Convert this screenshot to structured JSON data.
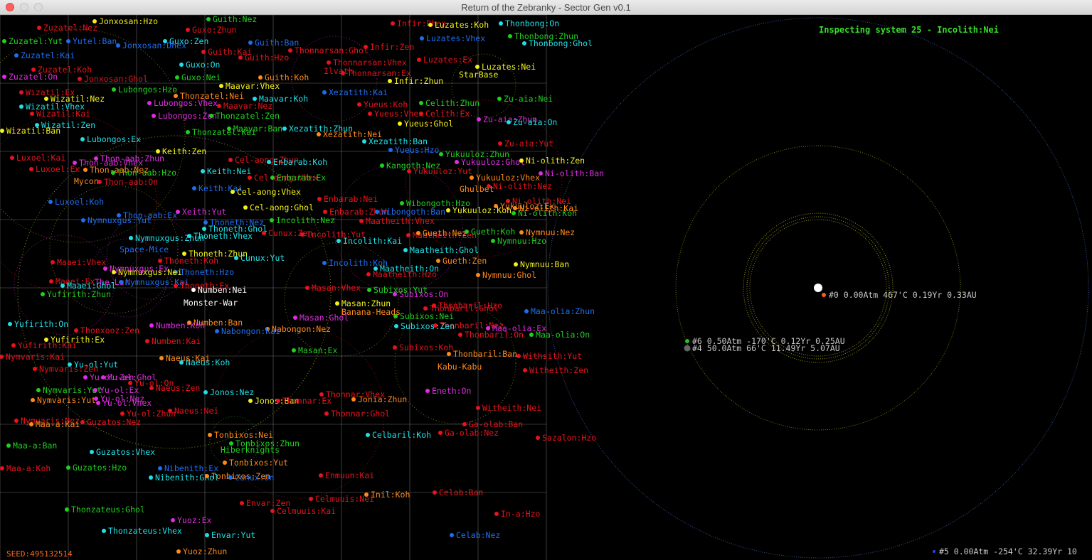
{
  "window": {
    "title": "Return of the Zebranky - Sector Gen v0.1"
  },
  "inspector": {
    "inspecting": "Inspecting system 25 - Incolith:Nei",
    "planets": [
      {
        "id": "star",
        "label": "",
        "color": "#ffffff"
      },
      {
        "id": "p0",
        "label": "#0 0.00Atm 467'C 0.19Yr 0.33AU",
        "color": "#ff5a14"
      },
      {
        "id": "p6",
        "label": "#6 0.50Atm -170'C 0.12Yr 0.25AU",
        "color": "#1ec81e"
      },
      {
        "id": "p4",
        "label": "#4 50.0Atm 66'C 11.49Yr 5.07AU",
        "color": "#666666"
      },
      {
        "id": "p5",
        "label": "#5 0.00Atm -254'C 32.39Yr 10",
        "color": "#1e4be6"
      }
    ]
  },
  "seed_label": "SEED:495132514",
  "palette": {
    "red": "#e8131b",
    "orange": "#ff8a1a",
    "yellow": "#f1f01c",
    "green": "#1fd11f",
    "cyan": "#20e0e6",
    "blue": "#1e6ef0",
    "magenta": "#de2ee0",
    "white": "#ffffff"
  },
  "systems": [
    [
      "Zuzatel:Nez",
      "red"
    ],
    [
      "Jonxosan:Hzo",
      "yellow"
    ],
    [
      "Guith:Nez",
      "green"
    ],
    [
      "Infir:Dhex",
      "red"
    ],
    [
      "Luzates:Koh",
      "yellow"
    ],
    [
      "Thonbong:On",
      "cyan"
    ],
    [
      "Zuzatel:Yut",
      "green"
    ],
    [
      "Yutel:Ban",
      "blue"
    ],
    [
      "Guxo:Zen",
      "cyan"
    ],
    [
      "Jonxosan:Dhex",
      "blue"
    ],
    [
      "Guxo:Zhun",
      "red"
    ],
    [
      "Guith:Ban",
      "blue"
    ],
    [
      "Thonnarsan:Ghol",
      "red"
    ],
    [
      "Infir:Zen",
      "red"
    ],
    [
      "Luzates:Vhex",
      "blue"
    ],
    [
      "Thonbong:Zhun",
      "green"
    ],
    [
      "Thonbong:Ghol",
      "cyan"
    ],
    [
      "Zuzatel:Kai",
      "blue"
    ],
    [
      "Guith:Kai",
      "red"
    ],
    [
      "Guith:Hzo",
      "red"
    ],
    [
      "Thonnarsan:Vhex",
      "red"
    ],
    [
      "Luzates:Ex",
      "red"
    ],
    [
      "Luzates:Nei",
      "yellow"
    ],
    [
      "Zuzatel:Koh",
      "red"
    ],
    [
      "Guxo:On",
      "cyan"
    ],
    [
      "Zuzatel:On",
      "magenta"
    ],
    [
      "Jonxosan:Ghol",
      "red"
    ],
    [
      "Guxo:Nei",
      "green"
    ],
    [
      "Guith:Koh",
      "orange"
    ],
    [
      "Ilvath",
      "red"
    ],
    [
      "Thonnarsan:Ex",
      "red"
    ],
    [
      "StarBase",
      "yellow"
    ],
    [
      "Infir:Zhun",
      "yellow"
    ],
    [
      "Wizatil:Ex",
      "red"
    ],
    [
      "Lubongos:Hzo",
      "green"
    ],
    [
      "Maavar:Vhex",
      "yellow"
    ],
    [
      "Xezatith:Kai",
      "blue"
    ],
    [
      "Wizatil:Nez",
      "yellow"
    ],
    [
      "Thonzatel:Nei",
      "orange"
    ],
    [
      "Maavar:Koh",
      "cyan"
    ],
    [
      "Zu-aia:Nei",
      "green"
    ],
    [
      "Wizatil:Vhex",
      "cyan"
    ],
    [
      "Lubongos:Vhex",
      "magenta"
    ],
    [
      "Maavar:Nez",
      "red"
    ],
    [
      "Yueus:Koh",
      "red"
    ],
    [
      "Celith:Zhun",
      "green"
    ],
    [
      "Wizatil:Kai",
      "red"
    ],
    [
      "Lubongos:Zen",
      "magenta"
    ],
    [
      "Thonzatel:Zen",
      "green"
    ],
    [
      "Yueus:Vhex",
      "red"
    ],
    [
      "Celith:Ex",
      "red"
    ],
    [
      "Zu-aia:Zhun",
      "magenta"
    ],
    [
      "Wizatil:Zen",
      "cyan"
    ],
    [
      "Yueus:Ghol",
      "yellow"
    ],
    [
      "Zu-aia:On",
      "cyan"
    ],
    [
      "Wizatil:Ban",
      "yellow"
    ],
    [
      "Thonzatel:Kai",
      "green"
    ],
    [
      "Maavar:Ban",
      "green"
    ],
    [
      "Xezatith:Zhun",
      "cyan"
    ],
    [
      "Xezatith:Nei",
      "orange"
    ],
    [
      "Lubongos:Ex",
      "cyan"
    ],
    [
      "Xezatith:Ban",
      "cyan"
    ],
    [
      "Zu-aia:Yut",
      "red"
    ],
    [
      "Keith:Zen",
      "yellow"
    ],
    [
      "Yueus:Hzo",
      "blue"
    ],
    [
      "Yukuuloz:Zhun",
      "green"
    ],
    [
      "Luxoel:Kai",
      "red"
    ],
    [
      "Thon-aab:Zhun",
      "magenta"
    ],
    [
      "Cel-aong:Zhun",
      "red"
    ],
    [
      "Yukuuloz:Ghol",
      "magenta"
    ],
    [
      "Ni-olith:Zen",
      "yellow"
    ],
    [
      "Thon-aab:Vhex",
      "magenta"
    ],
    [
      "Enbarab:Koh",
      "cyan"
    ],
    [
      "Kangoth:Nez",
      "green"
    ],
    [
      "Luxoel:Ex",
      "red"
    ],
    [
      "Thon-aab:Nez",
      "orange"
    ],
    [
      "Keith:Nei",
      "cyan"
    ],
    [
      "Yukuuloz:Yut",
      "red"
    ],
    [
      "Ni-olith:Ban",
      "magenta"
    ],
    [
      "Thon-aab:Hzo",
      "green"
    ],
    [
      "Cel-aong:Vhex",
      "red"
    ],
    [
      "Enbarab:Ex",
      "green"
    ],
    [
      "Yukuuloz:Vhex",
      "orange"
    ],
    [
      "Mycon",
      "orange"
    ],
    [
      "Thon-aab:On",
      "red"
    ],
    [
      "Ghulbet",
      "orange"
    ],
    [
      "Ni-olith:Nez",
      "red"
    ],
    [
      "Keith:Kai",
      "blue"
    ],
    [
      "Cel-aong:Vhex",
      "yellow"
    ],
    [
      "Enbarab:Nei",
      "red"
    ],
    [
      "Ni-olith:Nei",
      "red"
    ],
    [
      "Luxoel:Koh",
      "blue"
    ],
    [
      "Wibongoth:Hzo",
      "green"
    ],
    [
      "Yukuuloz:Ex",
      "orange"
    ],
    [
      "Cel-aong:Ghol",
      "yellow"
    ],
    [
      "Enbarab:Zhun",
      "red"
    ],
    [
      "Ni-olith:Kai",
      "orange"
    ],
    [
      "Thon-aab:Ex",
      "blue"
    ],
    [
      "Xeith:Yut",
      "magenta"
    ],
    [
      "Wibongoth:Ban",
      "blue"
    ],
    [
      "Yukuuloz:Koh",
      "yellow"
    ],
    [
      "Ni-olith:Koh",
      "green"
    ],
    [
      "Nymnuxgus:Yut",
      "blue"
    ],
    [
      "Thoneth:Nez",
      "blue"
    ],
    [
      "Incolith:Nez",
      "green"
    ],
    [
      "Maatheith:Vhex",
      "red"
    ],
    [
      "Nymnuu:Nez",
      "orange"
    ],
    [
      "Thoneth:Ghol",
      "cyan"
    ],
    [
      "Cunux:Zen",
      "red"
    ],
    [
      "Incolith:Yut",
      "red"
    ],
    [
      "Maatheith:Zen",
      "red"
    ],
    [
      "Gueth:Nez",
      "orange"
    ],
    [
      "Gueth:Koh",
      "green"
    ],
    [
      "Nymnuxgus:Zhun",
      "cyan"
    ],
    [
      "Thoneth:Vhex",
      "cyan"
    ],
    [
      "Incolith:Kai",
      "cyan"
    ],
    [
      "Nymnuu:Hzo",
      "green"
    ],
    [
      "Space-Mice",
      "blue"
    ],
    [
      "Maatheith:Ghol",
      "cyan"
    ],
    [
      "Thoneth:Zhun",
      "yellow"
    ],
    [
      "Cunux:Yut",
      "cyan"
    ],
    [
      "Thoneth:Koh",
      "red"
    ],
    [
      "Gueth:Zen",
      "orange"
    ],
    [
      "Nymnuu:Ban",
      "yellow"
    ],
    [
      "Maaei:Vhex",
      "red"
    ],
    [
      "Incolith:Koh",
      "blue"
    ],
    [
      "Maatheith:On",
      "cyan"
    ],
    [
      "Nymnuxgus:Ex",
      "magenta"
    ],
    [
      "Thoneth:Hzo",
      "blue"
    ],
    [
      "Nymnuxgus:Nei",
      "yellow"
    ],
    [
      "Nymnuu:Ghol",
      "orange"
    ],
    [
      "The-Lur",
      "magenta"
    ],
    [
      "Maatheith:Hzo",
      "red"
    ],
    [
      "Maaei:Ex",
      "red"
    ],
    [
      "Nymnuxgus:Kai",
      "blue"
    ],
    [
      "Maaei:Ghol",
      "cyan"
    ],
    [
      "Thoneth:Ex",
      "red"
    ],
    [
      "Subixos:Yut",
      "green"
    ],
    [
      "Numben:Nei",
      "white"
    ],
    [
      "Masan:Vhex",
      "red"
    ],
    [
      "Subixos:On",
      "magenta"
    ],
    [
      "Yufirith:Zhun",
      "green"
    ],
    [
      "Monster-War",
      "white"
    ],
    [
      "Masan:Zhun",
      "yellow"
    ],
    [
      "Thonbaril:Hzo",
      "red"
    ],
    [
      "Maa-olia:Zhun",
      "blue"
    ],
    [
      "Banana-Heads",
      "orange"
    ],
    [
      "Thonbaril:Ghol",
      "red"
    ],
    [
      "Masan:Ghol",
      "magenta"
    ],
    [
      "Subixos:Nei",
      "green"
    ],
    [
      "Thonbaril:Nez",
      "red"
    ],
    [
      "Yufirith:On",
      "cyan"
    ],
    [
      "Numben:Ban",
      "orange"
    ],
    [
      "Numben:Koh",
      "magenta"
    ],
    [
      "Subixos:Zen",
      "cyan"
    ],
    [
      "Maa-olia:Ex",
      "magenta"
    ],
    [
      "Thonxooz:Zen",
      "red"
    ],
    [
      "Nabongon:Nez",
      "orange"
    ],
    [
      "Nabongon:Kai",
      "blue"
    ],
    [
      "Thonbaril:On",
      "red"
    ],
    [
      "Maa-olia:On",
      "green"
    ],
    [
      "Yufirith:Ex",
      "yellow"
    ],
    [
      "Numben:Kai",
      "red"
    ],
    [
      "Subixos:Koh",
      "red"
    ],
    [
      "Masan:Ex",
      "green"
    ],
    [
      "Yufirith:Kai",
      "red"
    ],
    [
      "Thonbaril:Ban",
      "orange"
    ],
    [
      "Withsith:Yut",
      "red"
    ],
    [
      "Nymvaris:Kai",
      "red"
    ],
    [
      "Naeus:Kai",
      "orange"
    ],
    [
      "Kabu-Kabu",
      "orange"
    ],
    [
      "Naeus:Koh",
      "cyan"
    ],
    [
      "Yu-ol:Yut",
      "cyan"
    ],
    [
      "Nymvaris:Zen",
      "red"
    ],
    [
      "Witheith:Zen",
      "red"
    ],
    [
      "Yu-ol:Zen",
      "magenta"
    ],
    [
      "Yu-ol:Ghol",
      "magenta"
    ],
    [
      "Yu-ol:On",
      "red"
    ],
    [
      "Naeus:Zen",
      "red"
    ],
    [
      "Eneth:On",
      "magenta"
    ],
    [
      "Jonos:Nez",
      "cyan"
    ],
    [
      "Nymvaris:Yut",
      "green"
    ],
    [
      "Yu-ol:Ex",
      "magenta"
    ],
    [
      "Thonnar:Vhex",
      "red"
    ],
    [
      "Nymvaris:Yut",
      "orange"
    ],
    [
      "Yu-ol:Nez",
      "magenta"
    ],
    [
      "Jonos:Ban",
      "yellow"
    ],
    [
      "Jonia:Zhun",
      "orange"
    ],
    [
      "Thonnar:Ex",
      "red"
    ],
    [
      "Yu-ol:Vhex",
      "magenta"
    ],
    [
      "Witheith:Nei",
      "red"
    ],
    [
      "Yu-ol:Zhun",
      "red"
    ],
    [
      "Naeus:Nei",
      "red"
    ],
    [
      "Thonnar:Ghol",
      "red"
    ],
    [
      "Nymvaris:Nez",
      "red"
    ],
    [
      "Guzatos:Nez",
      "red"
    ],
    [
      "Maa-a:Kai",
      "orange"
    ],
    [
      "Ga-olab:Ban",
      "red"
    ],
    [
      "Ga-olab:Nez",
      "red"
    ],
    [
      "Tonbixos:Nei",
      "orange"
    ],
    [
      "Celbaril:Koh",
      "cyan"
    ],
    [
      "Sazalon:Hzo",
      "red"
    ],
    [
      "Tonbixos:Zhun",
      "green"
    ],
    [
      "Maa-a:Ban",
      "green"
    ],
    [
      "Guzatos:Vhex",
      "cyan"
    ],
    [
      "Hiberknights",
      "green"
    ],
    [
      "Guzatos:Hzo",
      "green"
    ],
    [
      "Tonbixos:Yut",
      "orange"
    ],
    [
      "Maa-a:Koh",
      "red"
    ],
    [
      "Nibenith:Ex",
      "blue"
    ],
    [
      "Nibenith:Ghol",
      "cyan"
    ],
    [
      "Tonbixos:Zen",
      "orange"
    ],
    [
      "Cunux:On",
      "blue"
    ],
    [
      "Enmuun:Kai",
      "red"
    ],
    [
      "Inil:Koh",
      "orange"
    ],
    [
      "Celab:Ban",
      "red"
    ],
    [
      "Celmuuis:Nei",
      "red"
    ],
    [
      "Envar:Zen",
      "red"
    ],
    [
      "Thonzateus:Ghol",
      "green"
    ],
    [
      "Celmuuis:Kai",
      "red"
    ],
    [
      "In-a:Hzo",
      "red"
    ],
    [
      "Yuoz:Ex",
      "magenta"
    ],
    [
      "Thonzateus:Vhex",
      "cyan"
    ],
    [
      "Envar:Yut",
      "cyan"
    ],
    [
      "Celab:Nez",
      "blue"
    ],
    [
      "Yuoz:Zhun",
      "orange"
    ]
  ]
}
